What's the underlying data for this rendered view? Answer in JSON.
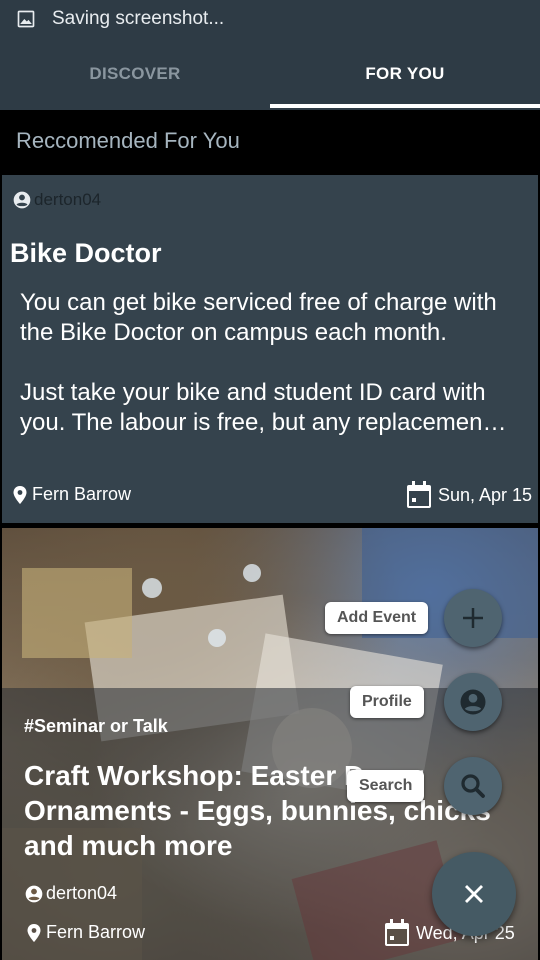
{
  "status_bar": {
    "icon": "image-icon",
    "text": "Saving screenshot..."
  },
  "tabs": [
    {
      "label": "DISCOVER",
      "selected": false
    },
    {
      "label": "FOR YOU",
      "selected": true
    }
  ],
  "section_title": "Reccomended For You",
  "cards": [
    {
      "author": "derton04",
      "title": "Bike Doctor",
      "description": "You can get bike serviced free of charge with the Bike Doctor on campus each month.\n\nJust take your bike and student ID card with you. The labour is free, but any replacemen…",
      "location": "Fern Barrow",
      "date": "Sun, Apr 15"
    },
    {
      "category": "#Seminar or Talk",
      "title": "Craft Workshop: Easter Decor Ornaments - Eggs, bunnies, chicks and much more",
      "author": "derton04",
      "location": "Fern Barrow",
      "date": "Wed, Apr 25"
    }
  ],
  "fab_menu": {
    "actions": [
      {
        "label": "Add Event",
        "icon": "add-icon"
      },
      {
        "label": "Profile",
        "icon": "account-circle-icon"
      },
      {
        "label": "Search",
        "icon": "search-icon"
      }
    ],
    "close_icon": "close-icon"
  },
  "colors": {
    "primary": "#2e3b45",
    "card": "#35434d",
    "fab": "#4f6470"
  }
}
